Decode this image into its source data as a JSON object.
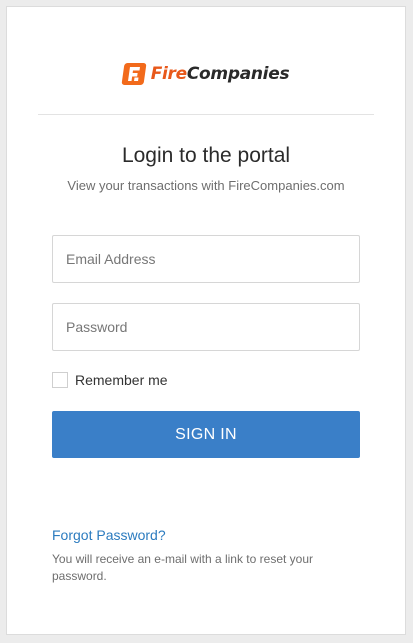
{
  "brand": {
    "name_part1": "Fire",
    "name_part2": "Companies",
    "logo_icon": "brand-logo-icon",
    "color_primary": "#f26a1b"
  },
  "login": {
    "title": "Login to the portal",
    "subtitle": "View your transactions with FireCompanies.com"
  },
  "form": {
    "email_placeholder": "Email Address",
    "email_value": "",
    "password_placeholder": "Password",
    "password_value": "",
    "remember_label": "Remember me",
    "remember_checked": false,
    "submit_label": "SIGN IN",
    "submit_color": "#3a7fc8"
  },
  "forgot": {
    "link_label": "Forgot Password?",
    "note": "You will receive an e-mail with a link to reset your password.",
    "link_color": "#2b7bbf"
  }
}
